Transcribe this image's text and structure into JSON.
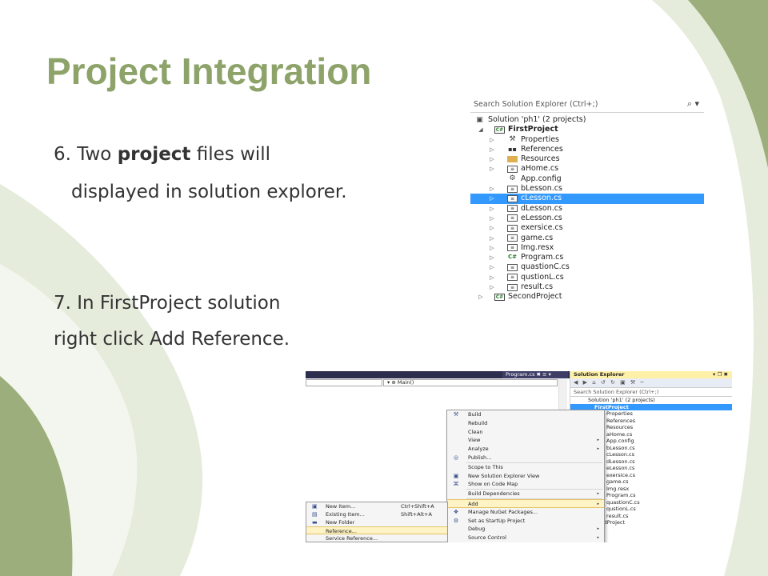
{
  "slide": {
    "title": "Project Integration",
    "step6_prefix": "6. Two ",
    "step6_bold": "project",
    "step6_suffix": " files will",
    "step6_line2": "displayed in solution explorer.",
    "step7_line1": "7. In FirstProject solution",
    "step7_line2": "right click Add Reference.",
    "colors": {
      "title": "#8da36a",
      "swoosh_dark": "#9cae7b",
      "swoosh_light": "#e6ecdc"
    }
  },
  "explorer1": {
    "search_placeholder": "Search Solution Explorer (Ctrl+;)",
    "search_icon": "⌕ ▾",
    "rows": [
      {
        "label": "Solution 'ph1' (2 projects)",
        "arrow": "",
        "icon": "sln-icon",
        "glyph": "▣"
      },
      {
        "label": "FirstProject",
        "arrow": "◢",
        "icon": "csproj-icon",
        "glyph": "C#"
      },
      {
        "label": "Properties",
        "arrow": "▷",
        "icon": "wrench-icon",
        "glyph": "⚒"
      },
      {
        "label": "References",
        "arrow": "▷",
        "icon": "references-icon",
        "glyph": "▪▪"
      },
      {
        "label": "Resources",
        "arrow": "▷",
        "icon": "folder-icon",
        "glyph": ""
      },
      {
        "label": "aHome.cs",
        "arrow": "▷",
        "icon": "form-icon",
        "glyph": "≡"
      },
      {
        "label": "App.config",
        "arrow": "",
        "icon": "config-icon",
        "glyph": "⚙"
      },
      {
        "label": "bLesson.cs",
        "arrow": "▷",
        "icon": "form-icon",
        "glyph": "≡"
      },
      {
        "label": "cLesson.cs",
        "arrow": "▷",
        "icon": "form-icon",
        "glyph": "≡"
      },
      {
        "label": "dLesson.cs",
        "arrow": "▷",
        "icon": "form-icon",
        "glyph": "≡"
      },
      {
        "label": "eLesson.cs",
        "arrow": "▷",
        "icon": "form-icon",
        "glyph": "≡"
      },
      {
        "label": "exersice.cs",
        "arrow": "▷",
        "icon": "form-icon",
        "glyph": "≡"
      },
      {
        "label": "game.cs",
        "arrow": "▷",
        "icon": "form-icon",
        "glyph": "≡"
      },
      {
        "label": "Img.resx",
        "arrow": "▷",
        "icon": "resx-icon",
        "glyph": "≡"
      },
      {
        "label": "Program.cs",
        "arrow": "▷",
        "icon": "cs-file-icon",
        "glyph": "C#"
      },
      {
        "label": "quastionC.cs",
        "arrow": "▷",
        "icon": "form-icon",
        "glyph": "≡"
      },
      {
        "label": "qustionL.cs",
        "arrow": "▷",
        "icon": "form-icon",
        "glyph": "≡"
      },
      {
        "label": "result.cs",
        "arrow": "▷",
        "icon": "form-icon",
        "glyph": "≡"
      },
      {
        "label": "SecondProject",
        "arrow": "▷",
        "icon": "csproj-icon",
        "glyph": "C#"
      }
    ]
  },
  "vs": {
    "tab_label": "Program.cs ✖ ≡ ▾",
    "method_combo": "▾ ⊕ Main()",
    "explorer": {
      "header": "Solution Explorer",
      "header_controls": "▾ ❐ ✖",
      "toolbar": "◀ ▶ ⌂ ↺ ↻ ▣ ⚒ ─",
      "search": "Search Solution Explorer (Ctrl+;)",
      "items": [
        "Solution 'ph1' (2 projects)",
        "FirstProject",
        "Properties",
        "References",
        "Resources",
        "aHome.cs",
        "App.config",
        "bLesson.cs",
        "cLesson.cs",
        "dLesson.cs",
        "eLesson.cs",
        "exersice.cs",
        "game.cs",
        "Img.resx",
        "Program.cs",
        "quastionC.cs",
        "qustionL.cs",
        "result.cs",
        "condProject"
      ]
    },
    "context_menu": [
      {
        "label": "Build",
        "icon": "build-icon",
        "glyph": "⚒",
        "arrow": ""
      },
      {
        "label": "Rebuild",
        "icon": "",
        "glyph": "",
        "arrow": ""
      },
      {
        "label": "Clean",
        "icon": "",
        "glyph": "",
        "arrow": ""
      },
      {
        "label": "View",
        "icon": "",
        "glyph": "",
        "arrow": "▸"
      },
      {
        "label": "Analyze",
        "icon": "",
        "glyph": "",
        "arrow": "▸"
      },
      {
        "label": "Publish...",
        "icon": "publish-icon",
        "glyph": "◎",
        "arrow": ""
      },
      {
        "label": "Scope to This",
        "icon": "",
        "glyph": "",
        "arrow": ""
      },
      {
        "label": "New Solution Explorer View",
        "icon": "new-view-icon",
        "glyph": "▣",
        "arrow": ""
      },
      {
        "label": "Show on Code Map",
        "icon": "code-map-icon",
        "glyph": "⌘",
        "arrow": ""
      },
      {
        "label": "Build Dependencies",
        "icon": "",
        "glyph": "",
        "arrow": "▸"
      },
      {
        "label": "Add",
        "icon": "",
        "glyph": "",
        "arrow": "▸"
      },
      {
        "label": "Manage NuGet Packages...",
        "icon": "nuget-icon",
        "glyph": "❖",
        "arrow": ""
      },
      {
        "label": "Set as StartUp Project",
        "icon": "startup-icon",
        "glyph": "⚙",
        "arrow": ""
      },
      {
        "label": "Debug",
        "icon": "",
        "glyph": "",
        "arrow": "▸"
      },
      {
        "label": "Source Control",
        "icon": "",
        "glyph": "",
        "arrow": "▸"
      }
    ],
    "add_submenu": [
      {
        "label": "New Item...",
        "shortcut": "Ctrl+Shift+A",
        "glyph": "▣"
      },
      {
        "label": "Existing Item...",
        "shortcut": "Shift+Alt+A",
        "glyph": "▤"
      },
      {
        "label": "New Folder",
        "shortcut": "",
        "glyph": "▬"
      },
      {
        "label": "Reference...",
        "shortcut": "",
        "glyph": ""
      },
      {
        "label": "Service Reference...",
        "shortcut": "",
        "glyph": ""
      }
    ]
  }
}
